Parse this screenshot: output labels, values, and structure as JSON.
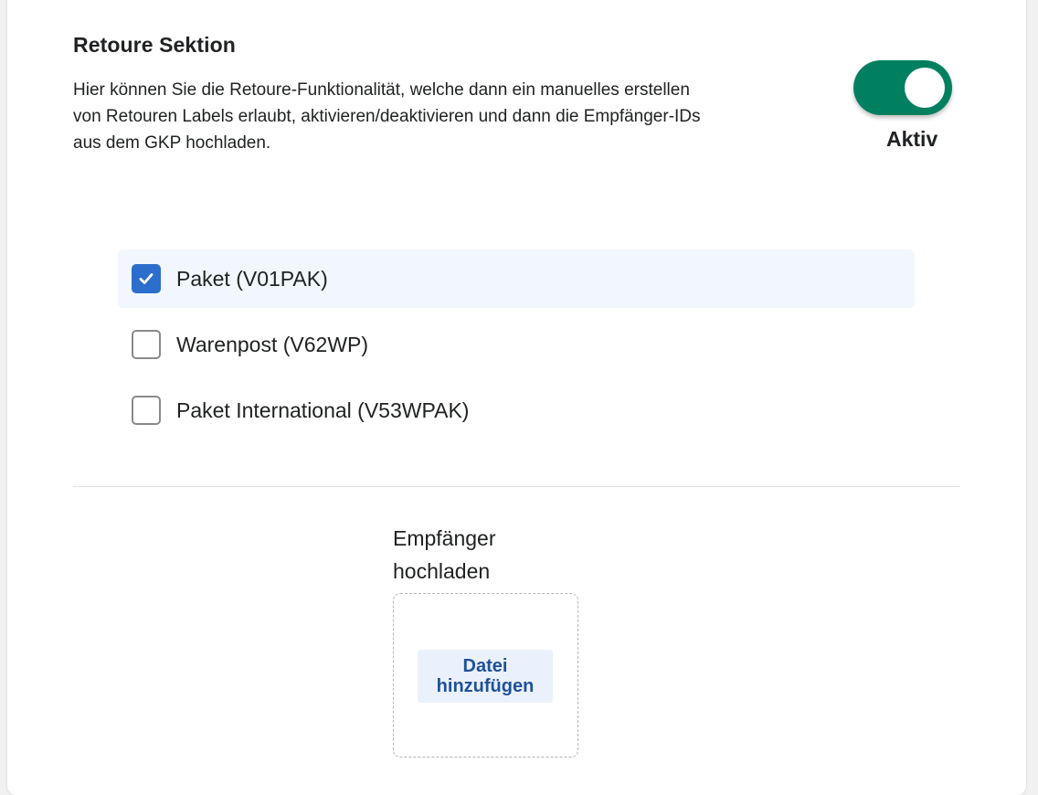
{
  "section": {
    "title": "Retoure Sektion",
    "description": "Hier können Sie die Retoure-Funktionalität, welche dann ein manuelles erstellen von Retouren Labels erlaubt, aktivieren/deaktivieren und dann die Empfänger-IDs aus dem GKP hochladen."
  },
  "toggle": {
    "state": "on",
    "status_label": "Aktiv",
    "color": "#008060"
  },
  "products": {
    "items": [
      {
        "label": "Paket (V01PAK)",
        "checked": true
      },
      {
        "label": "Warenpost (V62WP)",
        "checked": false
      },
      {
        "label": "Paket International (V53WPAK)",
        "checked": false
      }
    ]
  },
  "upload": {
    "label": "Empfänger hochladen",
    "button_label": "Datei hinzufügen"
  },
  "colors": {
    "accent": "#2c6ecb",
    "toggle_on": "#008060",
    "selected_row": "#f2f7fe"
  }
}
